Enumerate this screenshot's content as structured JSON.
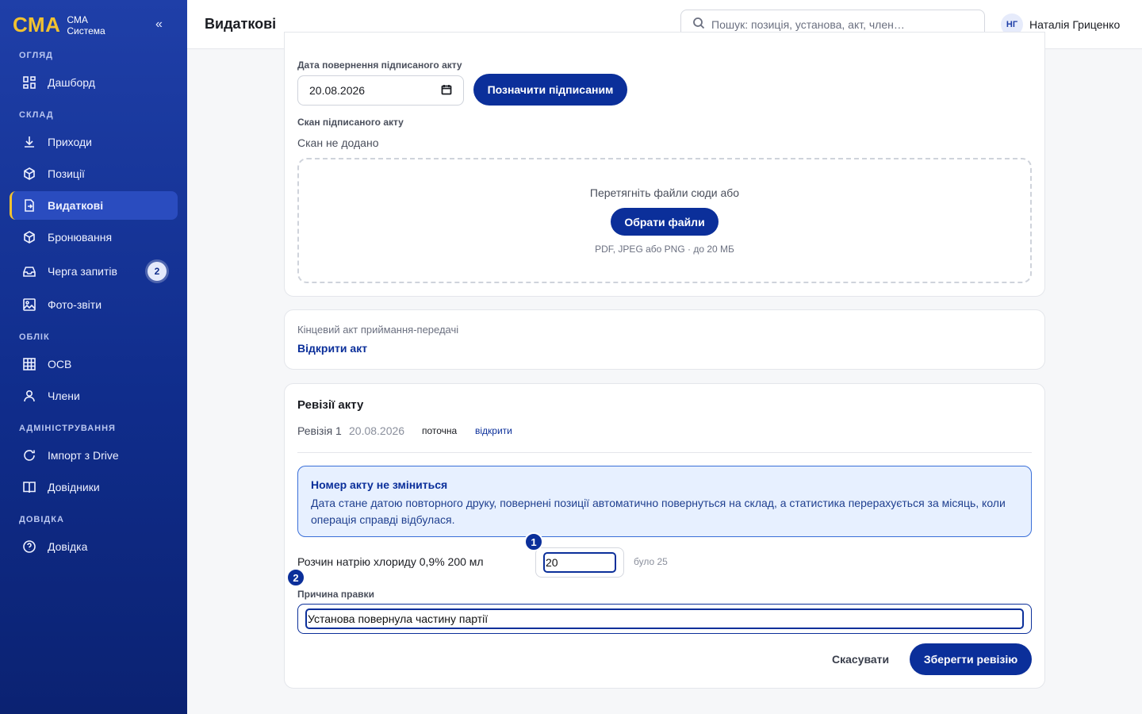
{
  "brand": {
    "logo": "СМА",
    "line1": "СМА",
    "line2": "Система",
    "collapse": "«"
  },
  "sidebar": {
    "sections": {
      "overview": "ОГЛЯД",
      "warehouse": "СКЛАД",
      "accounting": "ОБЛІК",
      "admin": "АДМІНІСТРУВАННЯ",
      "help": "ДОВІДКА"
    },
    "items": {
      "dashboard": "Дашборд",
      "incoming": "Приходи",
      "positions": "Позиції",
      "outgoing": "Видаткові",
      "reservations": "Бронювання",
      "queue": "Черга запитів",
      "queue_badge": "2",
      "photo_reports": "Фото-звіти",
      "osv": "ОСВ",
      "members": "Члени",
      "import_drive": "Імпорт з Drive",
      "references": "Довідники",
      "help": "Довідка"
    }
  },
  "header": {
    "title": "Видаткові",
    "search_placeholder": "Пошук: позиція, установа, акт, член…",
    "user_initials": "НГ",
    "user_name": "Наталія Гриценко"
  },
  "signed": {
    "date_label": "Дата повернення підписаного акту",
    "date_value": "20.08.2026",
    "mark_signed_button": "Позначити підписаним",
    "scan_label": "Скан підписаного акту",
    "scan_status": "Скан не додано",
    "drop_text": "Перетягніть файли сюди або",
    "choose_files_button": "Обрати файли",
    "drop_hint": "PDF, JPEG або PNG · до 20 МБ"
  },
  "final_act": {
    "label": "Кінцевий акт приймання-передачі",
    "open_link": "Відкрити акт"
  },
  "revisions": {
    "title": "Ревізії акту",
    "rows": [
      {
        "name": "Ревізія 1",
        "date": "20.08.2026",
        "status": "поточна",
        "link": "відкрити"
      }
    ],
    "info_title": "Номер акту не зміниться",
    "info_text": "Дата стане датою повторного друку, повернені позиції автоматично повернуться на склад, а статистика перерахується за місяць, коли операція справді відбулася.",
    "item_name": "Розчин натрію хлориду 0,9% 200 мл",
    "item_qty": "20",
    "item_was": "було 25",
    "marker_1": "1",
    "marker_2": "2",
    "reason_label": "Причина правки",
    "reason_value": "Установа повернула частину партії",
    "cancel_button": "Скасувати",
    "save_button": "Зберегти ревізію"
  }
}
